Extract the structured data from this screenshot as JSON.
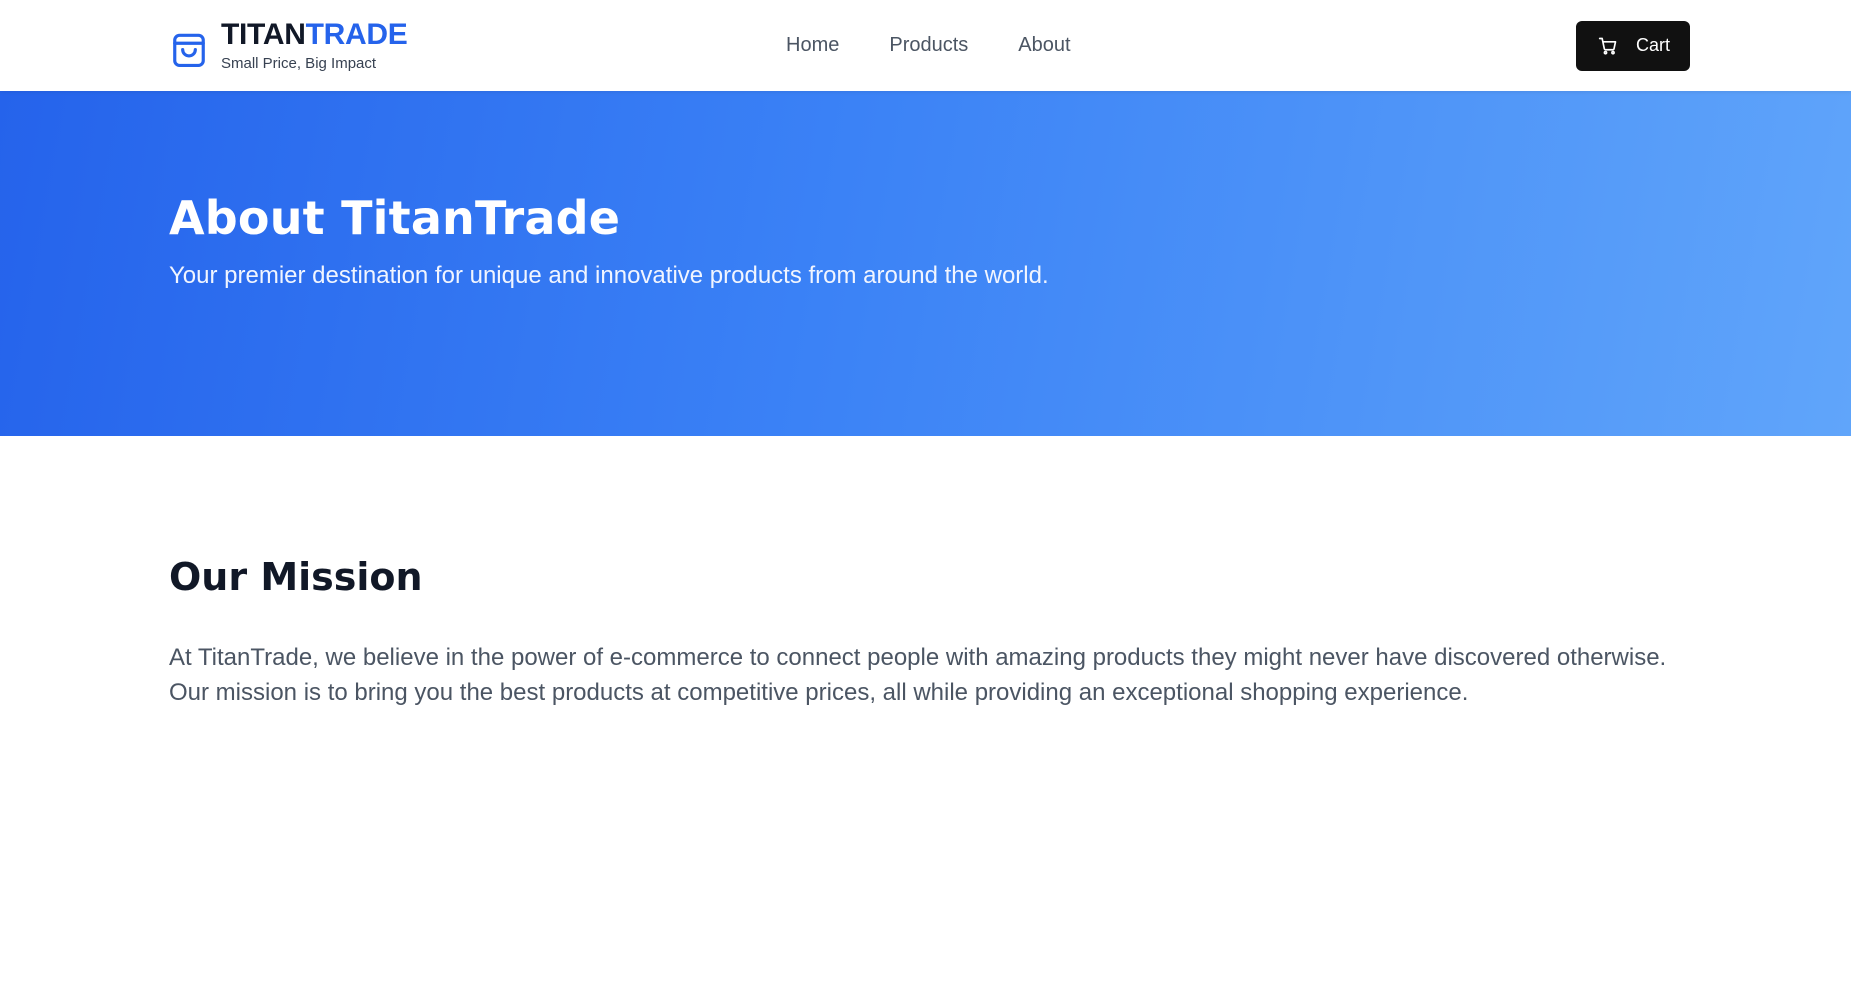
{
  "header": {
    "brand": {
      "name_part1": "TITAN",
      "name_part2": "TRADE",
      "tagline": "Small Price, Big Impact",
      "icon": "shopping-bag-icon",
      "accent_color": "#2563eb"
    },
    "nav": [
      {
        "label": "Home"
      },
      {
        "label": "Products"
      },
      {
        "label": "About"
      }
    ],
    "cart": {
      "label": "Cart",
      "icon": "shopping-cart-icon"
    }
  },
  "hero": {
    "title": "About TitanTrade",
    "subtitle": "Your premier destination for unique and innovative products from around the world.",
    "gradient_start": "#2563eb",
    "gradient_end": "#60a5fa"
  },
  "mission": {
    "title": "Our Mission",
    "text": "At TitanTrade, we believe in the power of e-commerce to connect people with amazing products they might never have discovered otherwise. Our mission is to bring you the best products at competitive prices, all while providing an exceptional shopping experience."
  }
}
